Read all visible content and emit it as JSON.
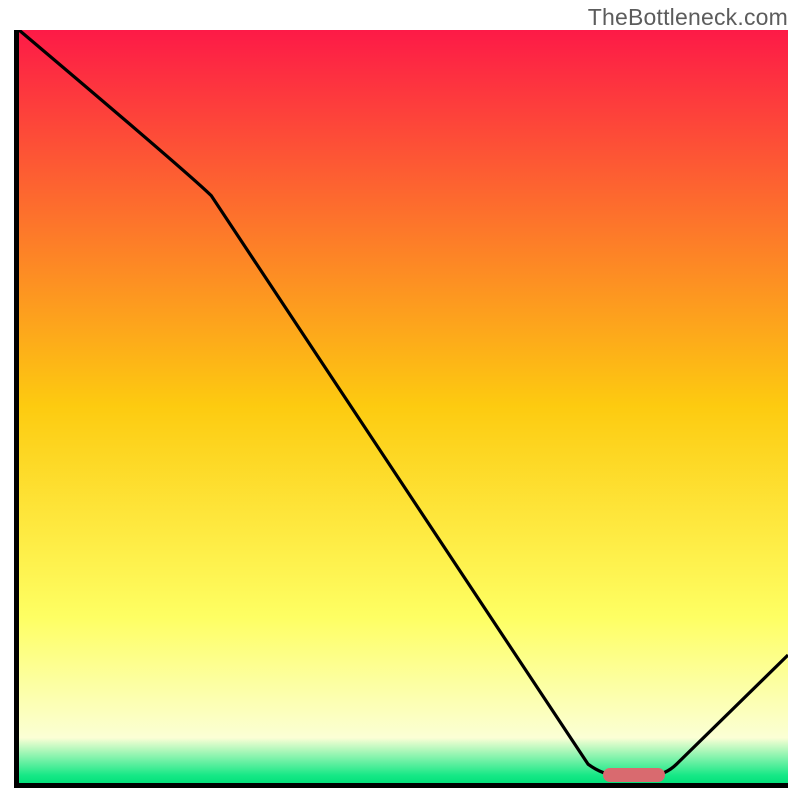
{
  "watermark": "TheBottleneck.com",
  "chart_data": {
    "type": "line",
    "title": "",
    "xlabel": "",
    "ylabel": "",
    "xlim": [
      0,
      100
    ],
    "ylim": [
      0,
      100
    ],
    "x": [
      0,
      25,
      76,
      84,
      100
    ],
    "values": [
      100,
      78,
      1,
      1,
      17
    ],
    "gradient_stops": [
      {
        "pos": 0,
        "color": "#fd1a47"
      },
      {
        "pos": 50,
        "color": "#fdcb10"
      },
      {
        "pos": 78,
        "color": "#feff63"
      },
      {
        "pos": 94,
        "color": "#fbffd5"
      },
      {
        "pos": 99,
        "color": "#15e886"
      },
      {
        "pos": 100,
        "color": "#05e17b"
      }
    ],
    "marker": {
      "x_start": 76,
      "x_end": 84,
      "y": 1,
      "color": "#d96a6f"
    },
    "source": "TheBottleneck.com"
  }
}
